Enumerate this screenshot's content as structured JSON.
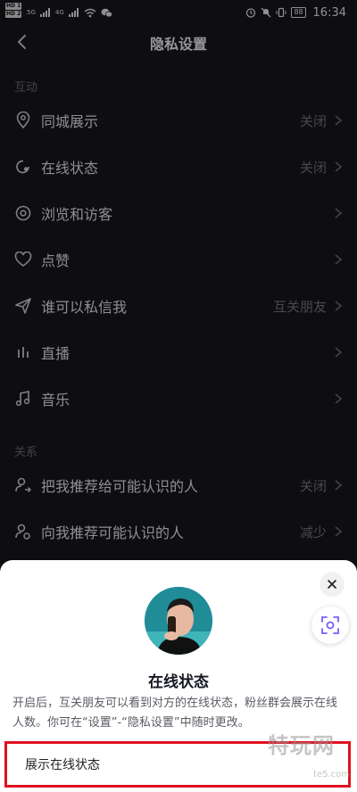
{
  "status_bar": {
    "sim1": "HD 1",
    "sim2": "HD 2",
    "net1": "5G",
    "net2": "4G",
    "battery": "88",
    "time": "16:34"
  },
  "header": {
    "title": "隐私设置"
  },
  "sections": {
    "interaction": "互动",
    "relation": "关系"
  },
  "rows": [
    {
      "label": "同城展示",
      "value": "关闭",
      "icon": "location-pin-icon"
    },
    {
      "label": "在线状态",
      "value": "关闭",
      "icon": "online-status-icon"
    },
    {
      "label": "浏览和访客",
      "value": "",
      "icon": "eye-icon"
    },
    {
      "label": "点赞",
      "value": "",
      "icon": "heart-icon"
    },
    {
      "label": "谁可以私信我",
      "value": "互关朋友",
      "icon": "paper-plane-icon"
    },
    {
      "label": "直播",
      "value": "",
      "icon": "bars-icon"
    },
    {
      "label": "音乐",
      "value": "",
      "icon": "music-note-icon"
    },
    {
      "label": "把我推荐给可能认识的人",
      "value": "关闭",
      "icon": "user-share-icon"
    },
    {
      "label": "向我推荐可能认识的人",
      "value": "减少",
      "icon": "user-sync-icon"
    }
  ],
  "sheet": {
    "title": "在线状态",
    "description": "开启后，互关朋友可以看到对方的在线状态，粉丝群会展示在线人数。你可在“设置”-“隐私设置”中随时更改。",
    "toggle_label": "展示在线状态",
    "highlight_color": "#e1101f"
  },
  "watermark": {
    "text": "特玩网",
    "url": "te5.com"
  }
}
